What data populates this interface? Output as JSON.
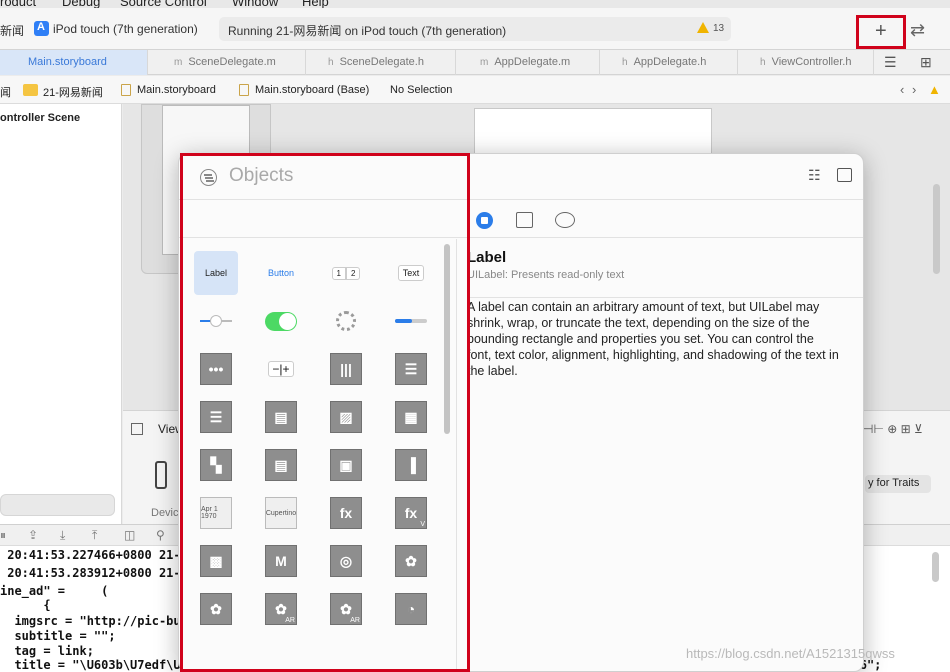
{
  "menubar": {
    "items": [
      "roduct",
      "Debug",
      "Source Control",
      "Window",
      "Help"
    ]
  },
  "toolbar": {
    "scheme_partial": "新闻",
    "device_name": "iPod touch (7th generation)",
    "activity_text": "Running 21-网易新闻 on iPod touch (7th generation)",
    "warning_count": "13",
    "library_button_glyph": "+",
    "colors": {
      "highlight": "#d0021b",
      "accent": "#2b7de9"
    }
  },
  "tabs": [
    {
      "label": "Main.storyboard",
      "icon": "storyboard-icon",
      "active": true
    },
    {
      "label": "SceneDelegate.m",
      "prefix": "m"
    },
    {
      "label": "SceneDelegate.h",
      "prefix": "h"
    },
    {
      "label": "AppDelegate.m",
      "prefix": "m"
    },
    {
      "label": "AppDelegate.h",
      "prefix": "h"
    },
    {
      "label": "ViewController.h",
      "prefix": "h"
    }
  ],
  "jumpbar": {
    "crumbs": [
      "闻",
      "21-网易新闻",
      "Main.storyboard",
      "Main.storyboard (Base)",
      "No Selection"
    ]
  },
  "outline": {
    "scene_label": "ontroller Scene"
  },
  "canvas_bar": {
    "view_as": "View",
    "devices_label": "Device",
    "traits_button": "y for Traits"
  },
  "library": {
    "search_placeholder": "Objects",
    "items": [
      {
        "name": "label",
        "kind": "label-control",
        "text": "Label",
        "selected": true
      },
      {
        "name": "button",
        "kind": "button-control",
        "text": "Button"
      },
      {
        "name": "segmented-control",
        "kind": "segmented",
        "segments": [
          "1",
          "2"
        ]
      },
      {
        "name": "text-field",
        "kind": "textfield",
        "text": "Text"
      },
      {
        "name": "slider",
        "kind": "slider"
      },
      {
        "name": "switch",
        "kind": "switch"
      },
      {
        "name": "activity-indicator",
        "kind": "spinner"
      },
      {
        "name": "progress-view",
        "kind": "progress"
      },
      {
        "name": "page-control",
        "kind": "tile",
        "glyph": "•••"
      },
      {
        "name": "stepper",
        "kind": "stepper",
        "text": "−|+"
      },
      {
        "name": "horizontal-stack-view",
        "kind": "tile",
        "glyph": "|||"
      },
      {
        "name": "vertical-stack-view",
        "kind": "tile",
        "glyph": "☰"
      },
      {
        "name": "table-view",
        "kind": "tile",
        "glyph": "☰"
      },
      {
        "name": "table-view-cell",
        "kind": "tile",
        "glyph": "▤"
      },
      {
        "name": "image-view",
        "kind": "tile",
        "glyph": "▨"
      },
      {
        "name": "collection-view",
        "kind": "tile",
        "glyph": "▦"
      },
      {
        "name": "collection-view-cell",
        "kind": "tile",
        "glyph": "▚"
      },
      {
        "name": "scroll-view",
        "kind": "tile",
        "glyph": "▤"
      },
      {
        "name": "text-view",
        "kind": "tile",
        "glyph": "▣"
      },
      {
        "name": "container-view",
        "kind": "tile",
        "glyph": "▐"
      },
      {
        "name": "date-picker",
        "kind": "tile-light",
        "glyph": "Apr 1 1970"
      },
      {
        "name": "picker-view",
        "kind": "tile-light",
        "glyph": "Cupertino"
      },
      {
        "name": "visual-effect-view",
        "kind": "tile",
        "glyph": "fx"
      },
      {
        "name": "visual-effect-vibrancy",
        "kind": "tile",
        "glyph": "fx",
        "badge": "V"
      },
      {
        "name": "map-kit-view",
        "kind": "tile",
        "glyph": "▩"
      },
      {
        "name": "metal-kit-view",
        "kind": "tile",
        "glyph": "M"
      },
      {
        "name": "scene-kit-view",
        "kind": "tile",
        "glyph": "◎"
      },
      {
        "name": "sprite-kit-view",
        "kind": "tile",
        "glyph": "✿"
      },
      {
        "name": "ar-scene-view",
        "kind": "tile",
        "glyph": "✿"
      },
      {
        "name": "ar-sk-view",
        "kind": "tile",
        "glyph": "✿",
        "badge": "AR"
      },
      {
        "name": "ar-view",
        "kind": "tile",
        "glyph": "✿",
        "badge": "AR"
      },
      {
        "name": "web-kit-view",
        "kind": "tile",
        "glyph": "◔"
      }
    ],
    "detail": {
      "title": "Label",
      "subtitle": "UILabel: Presents read-only text",
      "description": "A label can contain an arbitrary amount of text, but UILabel may shrink, wrap, or truncate the text, depending on the size of the bounding rectangle and properties you set. You can control the font, text color, alignment, highlighting, and shadowing of the text in the label."
    }
  },
  "console": {
    "lines": [
      " 20:41:53.227466+0800 21-",
      " 20:41:53.283912+0800 21-",
      "ine_ad\" =     (",
      "      {",
      "  imgsrc = \"http://pic-bu",
      "  subtitle = \"\";",
      "  tag = link;",
      "  title = \"\\U603b\\U7edf\\U5c31\\U804c\\U4eea\\U5f0f\\U5373\\U5c06\\U5f00\\U59cb \\U56fd\\U4f1a\\U5927\\U53a6\\U79e9\\U5e8f\\U4e95\\U7136\";"
    ]
  },
  "watermark": "https://blog.csdn.net/A1521315qwss"
}
